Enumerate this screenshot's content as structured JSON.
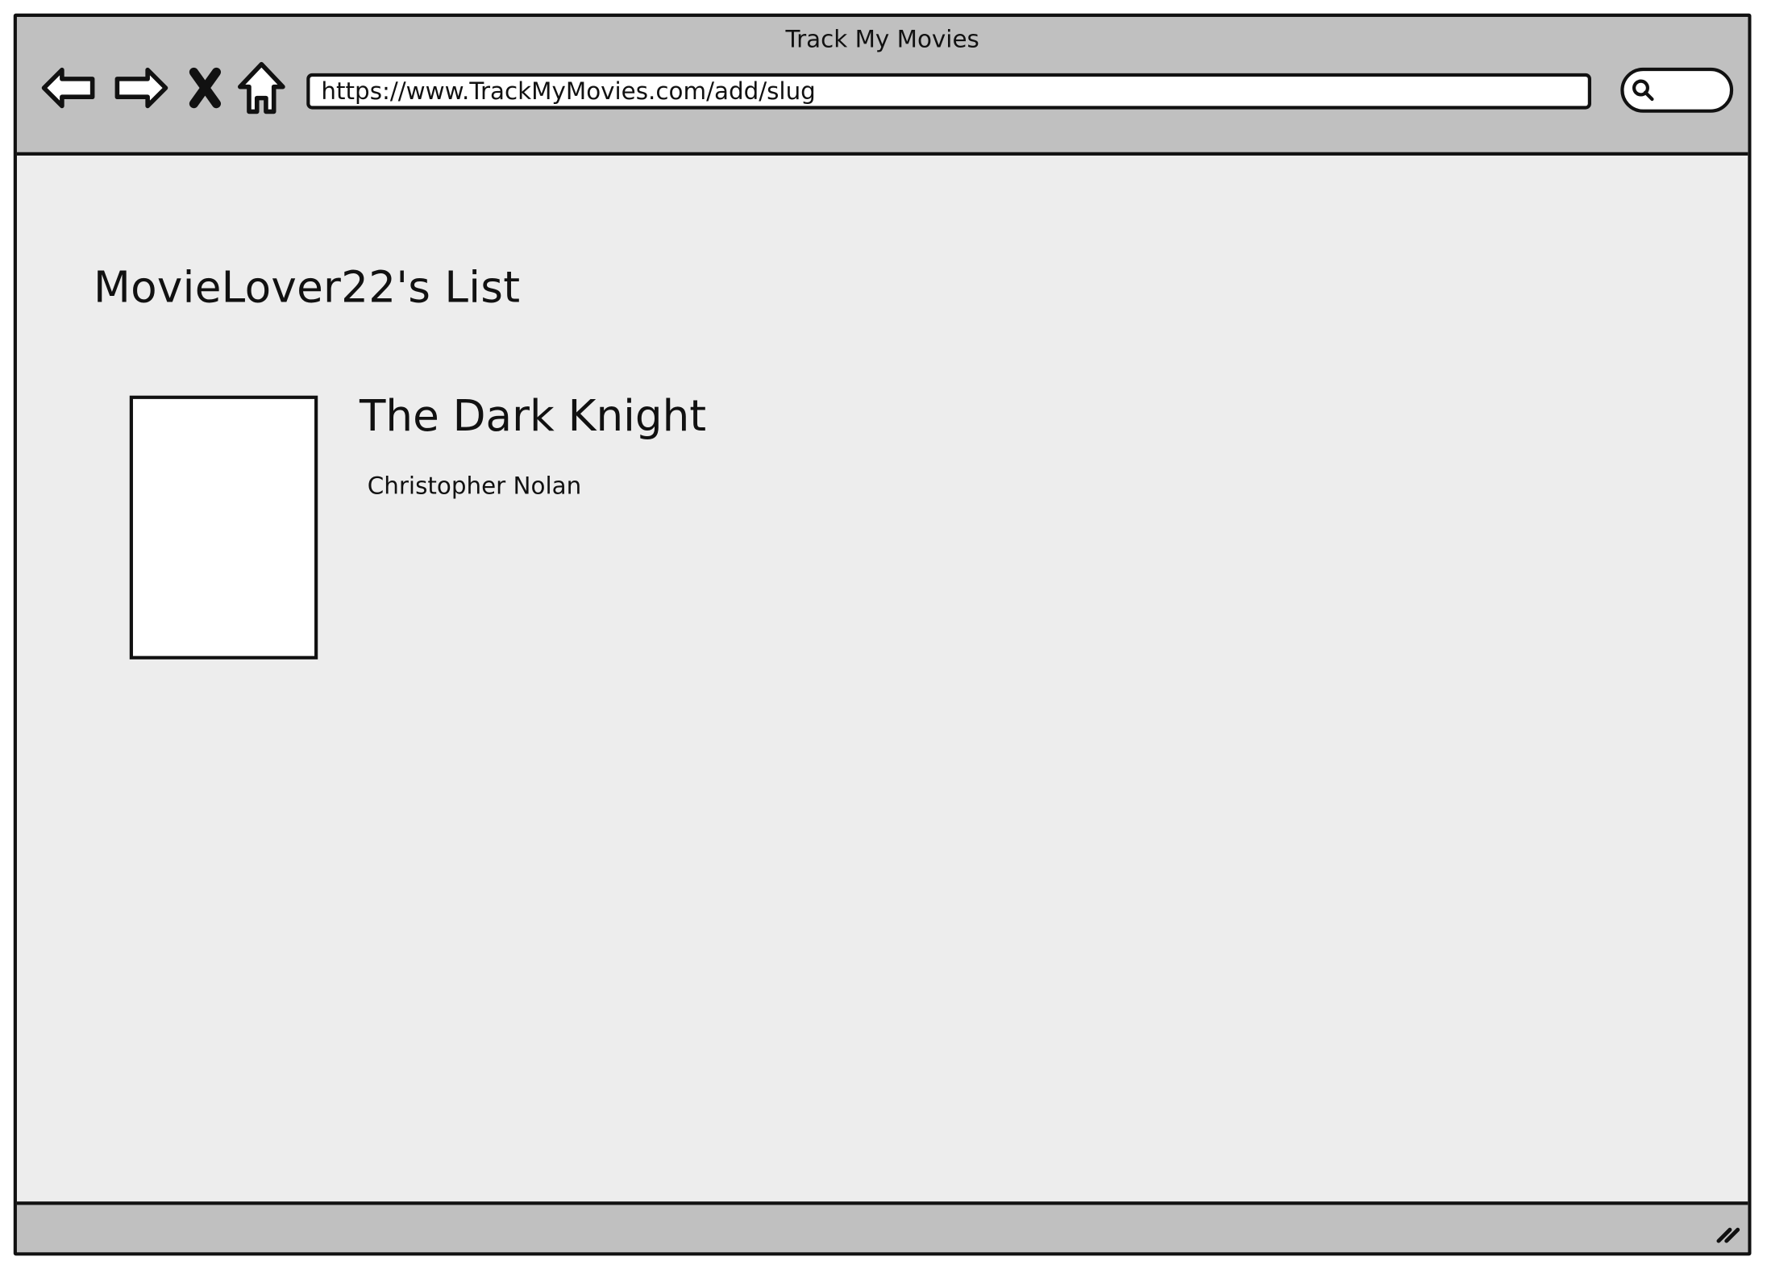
{
  "window": {
    "title": "Track My Movies"
  },
  "toolbar": {
    "icons": [
      "back-arrow-icon",
      "forward-arrow-icon",
      "stop-icon",
      "home-icon",
      "search-icon"
    ],
    "url": "https://www.TrackMyMovies.com/add/slug",
    "search_value": ""
  },
  "page": {
    "heading": "MovieLover22's List"
  },
  "movies": [
    {
      "title": "The Dark Knight",
      "director": "Christopher Nolan"
    }
  ],
  "colors": {
    "chrome": "#c0c0c0",
    "content_bg": "#ededed",
    "outline": "#111111",
    "field_bg": "#ffffff"
  }
}
